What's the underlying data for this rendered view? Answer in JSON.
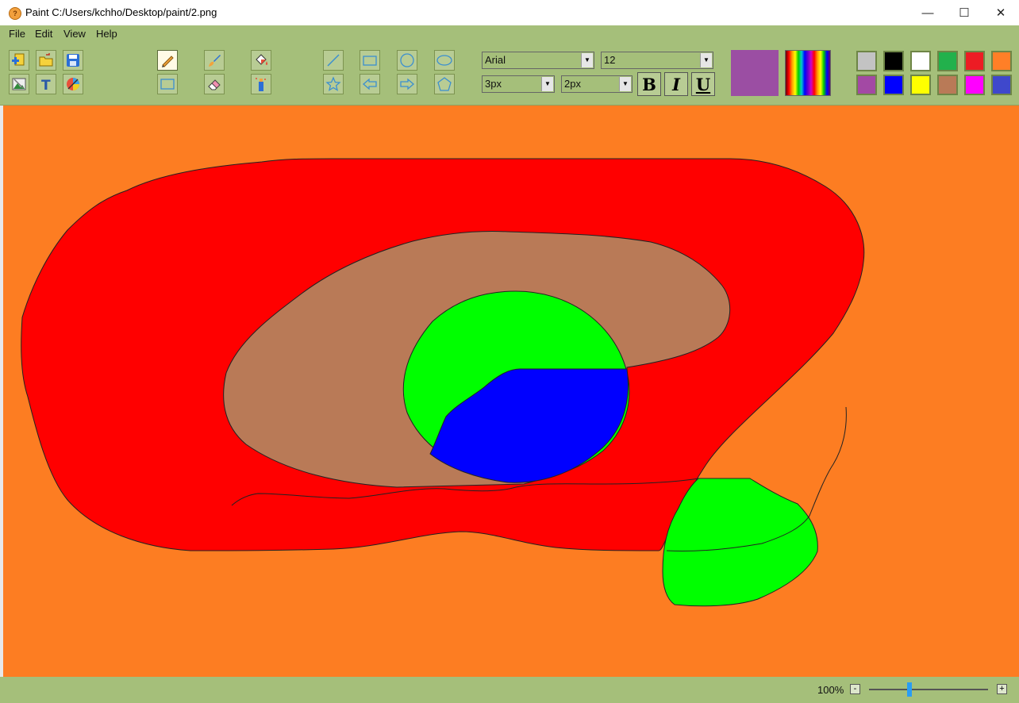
{
  "window": {
    "title": "Paint C:/Users/kchho/Desktop/paint/2.png",
    "app_icon": "paint-palette-icon",
    "minimize": "—",
    "maximize": "☐",
    "close": "✕"
  },
  "menu": [
    "File",
    "Edit",
    "View",
    "Help"
  ],
  "tools": {
    "file_tools": [
      "new-icon",
      "open-icon",
      "save-icon",
      "image-icon",
      "text-icon",
      "color-picker-icon"
    ],
    "draw_tools": [
      "pencil-icon",
      "brush-icon",
      "fill-icon",
      "rectangle-select-icon",
      "eraser-icon",
      "spray-icon"
    ],
    "shape_tools": [
      "line-icon",
      "rectangle-icon",
      "circle-icon",
      "ellipse-icon",
      "star-icon",
      "arrow-left-icon",
      "arrow-right-icon",
      "pentagon-icon"
    ],
    "active_tool": "pencil-icon"
  },
  "font": {
    "family": "Arial",
    "size": "12",
    "stroke_width": "3px",
    "border_width": "2px",
    "bold_label": "B",
    "italic_label": "I",
    "underline_label": "U"
  },
  "current_color": "#9b4ea3",
  "palette": [
    "#c3c3c3",
    "#000000",
    "#ffffff",
    "#22b14c",
    "#ed1c24",
    "#ff7f27",
    "#a349a4",
    "#0000ff",
    "#ffff00",
    "#b97a57",
    "#ff00ff",
    "#3f48cc"
  ],
  "canvas": {
    "background": "#fd7d22",
    "shapes": [
      "red-shape",
      "brown-shape",
      "green-circle",
      "blue-shape",
      "green-blob",
      "black-curve-line",
      "black-squiggle-line"
    ]
  },
  "status": {
    "zoom": "100%",
    "zoom_out": "-",
    "zoom_in": "+"
  }
}
